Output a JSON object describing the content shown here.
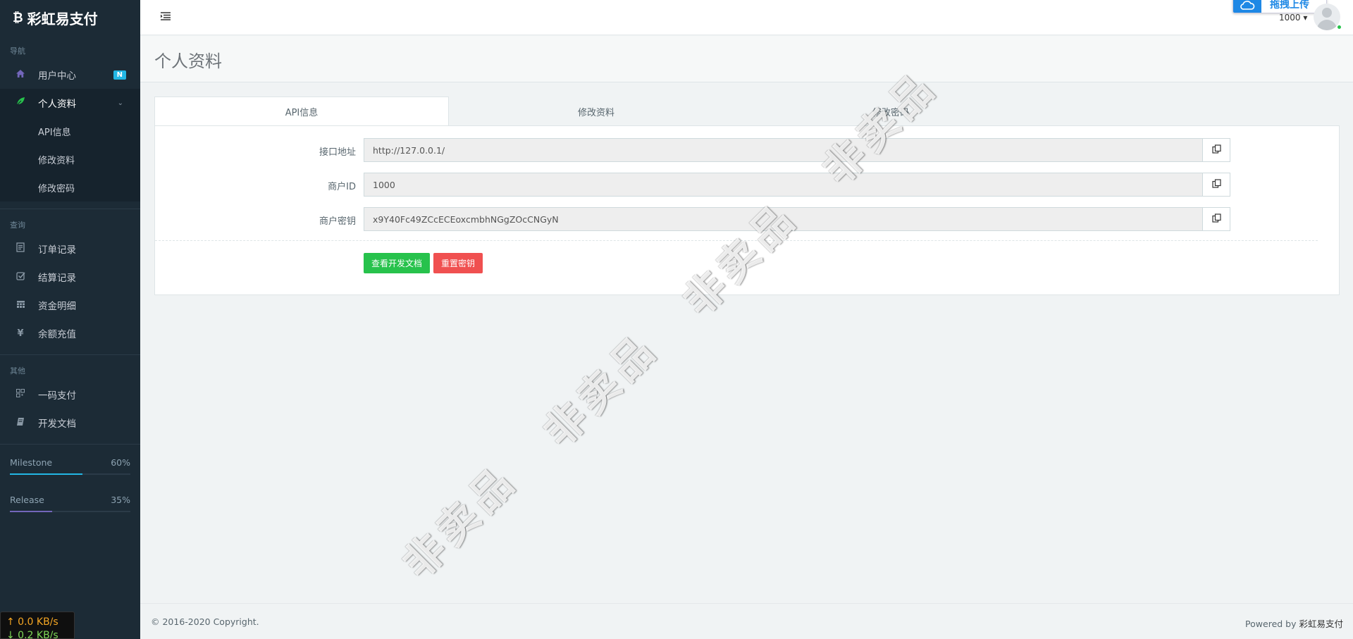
{
  "brand": {
    "logo": "₿",
    "name": "彩虹易支付"
  },
  "sidebar": {
    "nav_head": "导航",
    "items": [
      {
        "label": "用户中心",
        "icon": "home-icon",
        "badge": "N"
      },
      {
        "label": "个人资料",
        "icon": "leaf-icon"
      }
    ],
    "submenu": [
      "API信息",
      "修改资料",
      "修改密码"
    ],
    "query_head": "查询",
    "query_items": [
      {
        "label": "订单记录",
        "icon": "receipt-icon"
      },
      {
        "label": "结算记录",
        "icon": "check-square-icon"
      },
      {
        "label": "资金明细",
        "icon": "calendar-icon"
      },
      {
        "label": "余额充值",
        "icon": "yen-icon"
      }
    ],
    "other_head": "其他",
    "other_items": [
      {
        "label": "一码支付",
        "icon": "qrcode-icon"
      },
      {
        "label": "开发文档",
        "icon": "book-icon"
      }
    ],
    "progress": [
      {
        "label": "Milestone",
        "pct_label": "60%",
        "value": 0.6,
        "color": "#23b7e5"
      },
      {
        "label": "Release",
        "pct_label": "35%",
        "value": 0.35,
        "color": "#7266ba"
      }
    ]
  },
  "netspeed": {
    "up": "↑ 0.0 KB/s",
    "down": "↓ 0.2 KB/s"
  },
  "header": {
    "upload": "拖拽上传",
    "user": "1000 ▾"
  },
  "page": {
    "title": "个人资料"
  },
  "tabs": [
    "API信息",
    "修改资料",
    "修改密码"
  ],
  "form": {
    "rows": [
      {
        "label": "接口地址",
        "value": "http://127.0.0.1/"
      },
      {
        "label": "商户ID",
        "value": "1000"
      },
      {
        "label": "商户密钥",
        "value": "x9Y40Fc49ZCcECEoxcmbhNGgZOcCNGyN"
      }
    ],
    "btn_docs": "查看开发文档",
    "btn_reset": "重置密钥"
  },
  "watermark": "非卖品",
  "footer": {
    "copyright": "© 2016-2020 Copyright.",
    "powered_prefix": "Powered by ",
    "powered_name": "彩虹易支付"
  }
}
